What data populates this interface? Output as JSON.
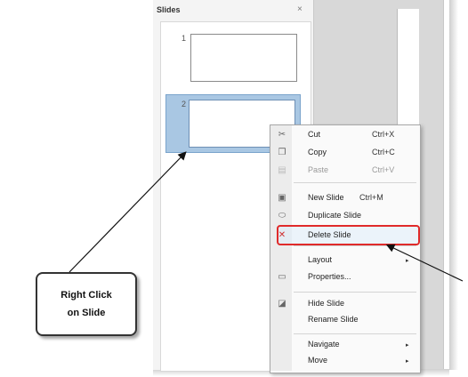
{
  "panel": {
    "title": "Slides",
    "close_glyph": "×",
    "slides": [
      {
        "number": "1"
      },
      {
        "number": "2"
      }
    ]
  },
  "context_menu": {
    "items": [
      {
        "label": "Cut",
        "shortcut": "Ctrl+X",
        "icon": "scissors-icon",
        "enabled": true
      },
      {
        "label": "Copy",
        "shortcut": "Ctrl+C",
        "icon": "copy-icon",
        "enabled": true
      },
      {
        "label": "Paste",
        "shortcut": "Ctrl+V",
        "icon": "paste-icon",
        "enabled": false
      },
      {
        "label": "New Slide",
        "shortcut": "Ctrl+M",
        "icon": "new-slide-icon",
        "enabled": true
      },
      {
        "label": "Duplicate Slide",
        "shortcut": "",
        "icon": "duplicate-slide-icon",
        "enabled": true
      },
      {
        "label": "Delete Slide",
        "shortcut": "",
        "icon": "delete-slide-icon",
        "enabled": true,
        "highlighted": true
      },
      {
        "label": "Layout",
        "shortcut": "",
        "icon": "",
        "enabled": true,
        "submenu": true
      },
      {
        "label": "Properties...",
        "shortcut": "",
        "icon": "properties-icon",
        "enabled": true
      },
      {
        "label": "Hide Slide",
        "shortcut": "",
        "icon": "hide-slide-icon",
        "enabled": true
      },
      {
        "label": "Rename Slide",
        "shortcut": "",
        "icon": "",
        "enabled": true
      },
      {
        "label": "Navigate",
        "shortcut": "",
        "icon": "",
        "enabled": true,
        "submenu": true
      },
      {
        "label": "Move",
        "shortcut": "",
        "icon": "",
        "enabled": true,
        "submenu": true
      }
    ],
    "submenu_glyph": "▸"
  },
  "callout": {
    "line1": "Right Click",
    "line2": "on Slide"
  },
  "colors": {
    "highlight_border": "#e02a2a",
    "selected_slide": "#a9c7e3"
  }
}
